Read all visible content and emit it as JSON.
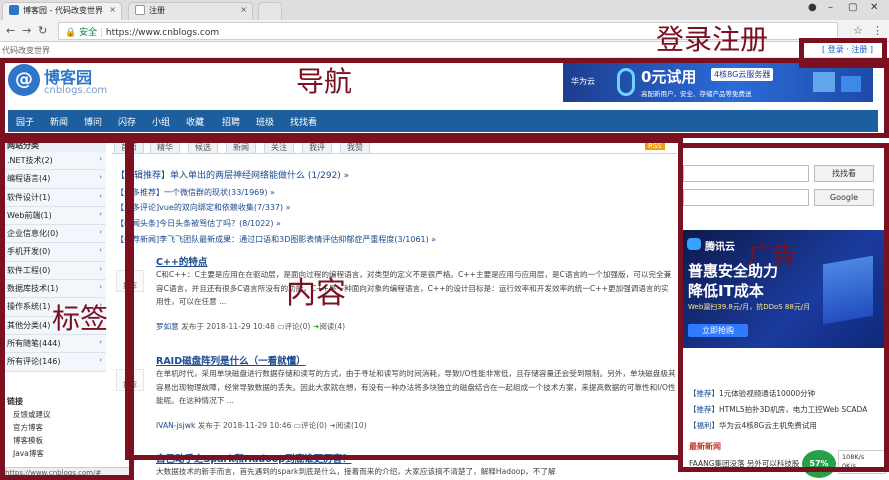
{
  "browser": {
    "tabs": [
      {
        "title": "博客园 - 代码改变世界",
        "active": true
      },
      {
        "title": "注册",
        "active": false
      }
    ],
    "url": "https://www.cnblogs.com",
    "secure_label": "安全"
  },
  "site": {
    "tagline": "代码改变世界",
    "login_links": "[ 登录 · 注册 ]",
    "logo_text": "博客园",
    "logo_sub": "cnblogs.com",
    "ad_banner": {
      "brand": "华为云",
      "headline": "0元试用",
      "badge": "4核8G云服务器",
      "sub": "高配新用户，安全、存储产品等免费送"
    }
  },
  "nav": [
    "园子",
    "新闻",
    "博问",
    "闪存",
    "小组",
    "收藏",
    "招聘",
    "班级",
    "找找看"
  ],
  "left_sidebar": {
    "title": "网站分类",
    "categories": [
      ".NET技术(2)",
      "编程语言(4)",
      "软件设计(1)",
      "Web前端(1)",
      "企业信息化(0)",
      "手机开发(0)",
      "软件工程(0)",
      "数据库技术(1)",
      "操作系统(1)",
      "其他分类(4)",
      "所有随笔(444)",
      "所有评论(146)"
    ],
    "links_title": "链接",
    "links": [
      "反馈或建议",
      "官方博客",
      "博客模板",
      "Java博客"
    ]
  },
  "center": {
    "subtabs": [
      "首页",
      "精华",
      "候选",
      "新闻",
      "关注",
      "我评",
      "我赞"
    ],
    "rss": "RSS",
    "headlines": [
      "【编辑推荐】单入单出的两层神经网络能做什么 (1/292) »",
      "【最多推荐】一个微信群的现状(33/1969) »",
      "【最多评论]vue的双向绑定和依赖收集(7/337) »",
      "【新闻头条]今日头条被骂估了吗？(8/1022) »",
      "【推荐新闻]李飞飞团队最新成果：通过口语和3D图影表情评估抑郁症严重程度(3/1061) »"
    ],
    "posts": [
      {
        "title": "C++的特点",
        "vote": "推荐",
        "body": "C和C++：C主要是应用在在驱动层，是面向过程的编程语言，对类型的定义不是很严格。C++主要是应用与应用层，是C语言的一个加强版，可以完全兼容C语言，并且还有很多C语言所没有的功能，C++是一种面向对象的编程语言，C++的设计目标是：运行效率和开发效率的统一C++更加强调语言的实用性，可以在任意 ...",
        "author": "罗如意",
        "meta": "发布于 2018-11-29 10:48",
        "comments": "评论(0)",
        "reads": "阅读(4)"
      },
      {
        "title": "RAID磁盘阵列是什么（一看就懂）",
        "vote": "推荐",
        "body": "在单机时代，采用单块磁盘进行数据存储和读写的方式，由于寻址和读写的时间消耗，导致I/O性能非常低，且存储容量还会受到限制。另外，单块磁盘极其容易出现物理故障，经常导致数据的丢失。因此大家就在想，有没有一种办法将多块独立的磁盘结合在一起组成一个技术方案，来提高数据的可靠性和I/O性能呢。在这种情况下 ...",
        "author": "IVAN-jsjwk",
        "meta": "发布于 2018-11-29 10:46",
        "comments": "评论(0)",
        "reads": "阅读(10)"
      },
      {
        "title": "自己动手之Spark和Hadoop到底谁更厉害？",
        "body": "大数据技术的新手而言，首先遇到的spark到底是什么，接着而来的介绍，大家应该搞不清楚了，解释Hadoop，不了解"
      }
    ]
  },
  "right_sidebar": {
    "search_btn1": "找找看",
    "search_btn2": "Google",
    "cloud_ad": {
      "brand": "腾讯云",
      "line1": "普惠安全助力",
      "line2": "降低IT成本",
      "offer": "Web漏扫39.8元/月，抗DDoS 88元/月",
      "cta": "立即抢购"
    },
    "news": [
      {
        "tag": "【推荐】",
        "text": "1元体验视频通话10000分钟"
      },
      {
        "tag": "【推荐】",
        "text": "HTML5拍扑3D机房，电力工控Web SCADA"
      },
      {
        "tag": "【福利】",
        "text": "华为云4核8G云主机免费试用"
      }
    ],
    "newest_title": "最新新闻",
    "newest_item": "FAANG集团没落 另外可以科技股"
  },
  "system": {
    "speed_percent": "57%",
    "speed_up": "108K/s",
    "speed_down": "0K/s",
    "status_url": "https://www.cnblogs.com/#"
  },
  "annotations": {
    "login": "登录注册",
    "nav": "导航",
    "content": "内容",
    "tags": "标签",
    "ad": "广告"
  },
  "colors": {
    "nav_bg": "#1d5f9e",
    "annotation": "#7a1020",
    "link": "#1a4a8f"
  }
}
